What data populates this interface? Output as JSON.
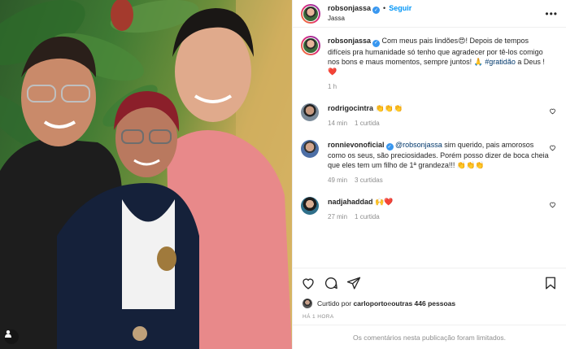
{
  "post": {
    "username": "robsonjassa",
    "follow_label": "Seguir",
    "location": "Jassa",
    "more_label": "•••",
    "caption": {
      "username": "robsonjassa",
      "text_1": "Com meus pais lindões😍! Depois de tempos difíceis pra humanidade só tenho que agradecer por tê-los comigo nos bons e maus momentos, sempre juntos! 🙏 ",
      "hashtag": "#gratidão",
      "text_2": " a Deus ! ❤️",
      "time": "1 h"
    },
    "comments": [
      {
        "username": "rodrigocintra",
        "text": "👏👏👏",
        "time": "14 min",
        "likes": "1 curtida"
      },
      {
        "username": "ronnievonoficial",
        "mention": "@robsonjassa",
        "text": " sim querido, pais amorosos como os seus, são preciosidades. Porém posso dizer de boca cheia que eles tem um filho de 1ª grandeza!!! 👏👏👏",
        "time": "49 min",
        "likes": "3 curtidas"
      },
      {
        "username": "nadjahaddad",
        "text": "🙌❤️",
        "time": "27 min",
        "likes": "1 curtida"
      }
    ],
    "liked_by_prefix": "Curtido por",
    "liked_by_user": "carloporto",
    "liked_by_mid": " e ",
    "liked_by_others": "outras 446 pessoas",
    "post_time": "HÁ 1 HORA",
    "comments_limited": "Os comentários nesta publicação foram limitados."
  },
  "icons": {
    "verified": "verified-badge",
    "like": "heart-icon",
    "comment": "comment-icon",
    "share": "paper-plane-icon",
    "save": "bookmark-icon",
    "tag": "person-tag-icon"
  },
  "colors": {
    "accent": "#0095f6",
    "verified": "#3897f0",
    "muted": "#8e8e8e",
    "text": "#262626"
  }
}
